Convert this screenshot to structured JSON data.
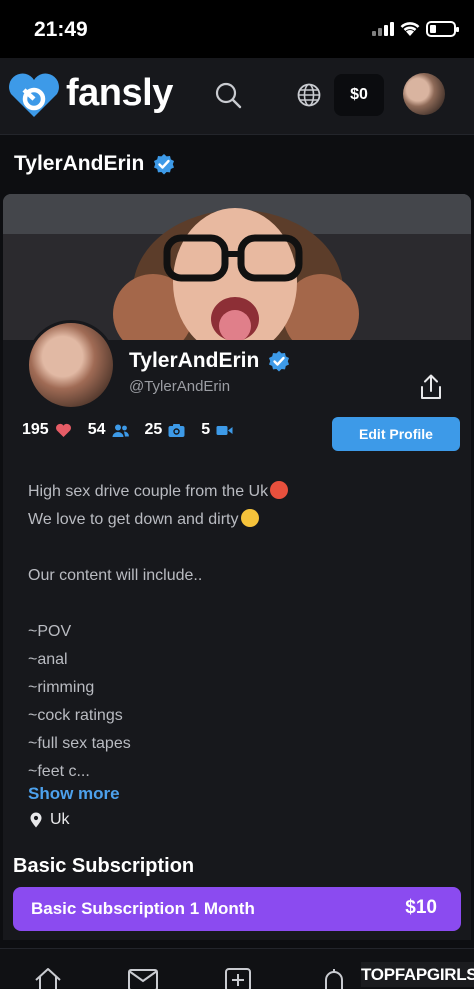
{
  "status_bar": {
    "time": "21:49"
  },
  "nav": {
    "brand": "fansly",
    "wallet": "$0",
    "icons": [
      "fansly-logo-icon",
      "search-icon",
      "globe-icon"
    ]
  },
  "header": {
    "title": "TylerAndErin"
  },
  "profile": {
    "name": "TylerAndErin",
    "handle": "@TylerAndErin",
    "stats": {
      "likes": "195",
      "followers": "54",
      "photos": "25",
      "videos": "5"
    },
    "edit_button": "Edit Profile"
  },
  "bio": {
    "lines": [
      "High sex drive couple from the Uk",
      "We love to get down and dirty",
      "",
      "Our content will include..",
      "",
      "~POV",
      "~anal",
      "~rimming",
      "~cock ratings",
      "~full sex tapes",
      "~feet c..."
    ],
    "show_more": "Show more",
    "location": "Uk"
  },
  "subscription": {
    "heading": "Basic Subscription",
    "button_label": "Basic Subscription 1 Month",
    "price": "$10"
  },
  "watermark": "TOPFAPGIRLS",
  "colors": {
    "accent": "#3d9ae8",
    "subscribe": "#8b4bf0",
    "background": "#17181c"
  }
}
